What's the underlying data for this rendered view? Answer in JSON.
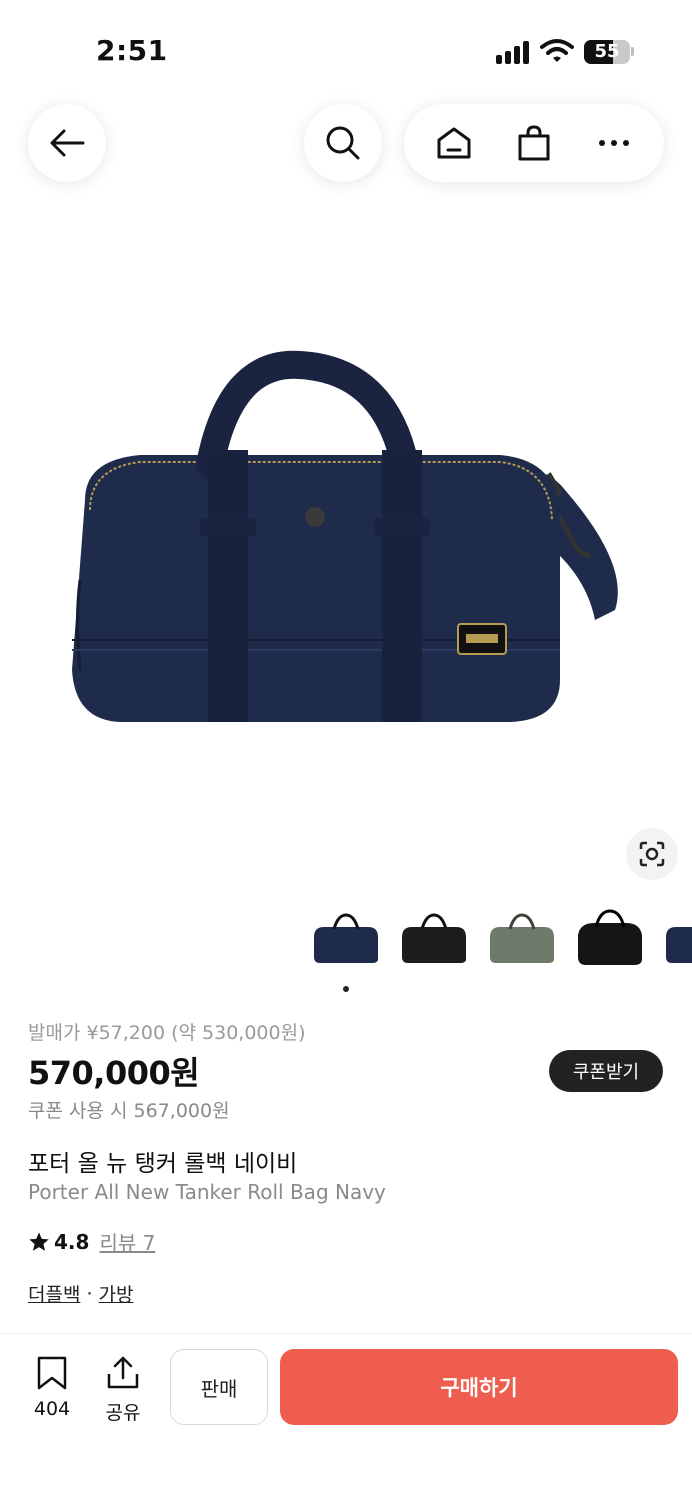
{
  "status": {
    "time": "2:51",
    "battery": "55"
  },
  "pricing": {
    "retail_label": "발매가 ¥57,200 (약 530,000원)",
    "price": "570,000원",
    "coupon_price": "쿠폰 사용 시 567,000원",
    "coupon_button": "쿠폰받기"
  },
  "product": {
    "name_ko": "포터 올 뉴 탱커 롤백 네이비",
    "name_en": "Porter All New Tanker Roll Bag Navy",
    "rating": "4.8",
    "reviews": "리뷰 7",
    "categories": [
      "더플백",
      "가방"
    ],
    "category_separator": "·",
    "thumbnail_colors": [
      "#1f2b4a",
      "#1c1c1c",
      "#707a6a",
      "#151515",
      "#1f2b4a"
    ]
  },
  "actions": {
    "save_count": "404",
    "share_label": "공유",
    "sell_label": "판매",
    "buy_label": "구매하기"
  },
  "colors": {
    "accent": "#ee5d4d",
    "navy": "#1f2b4a"
  }
}
